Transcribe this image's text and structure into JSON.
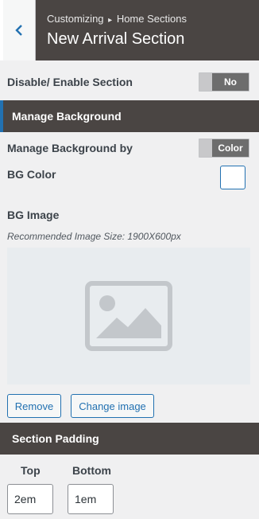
{
  "header": {
    "breadcrumb_parent": "Customizing",
    "breadcrumb_sep": "▸",
    "breadcrumb_child": "Home Sections",
    "title": "New Arrival Section"
  },
  "enable_section": {
    "label": "Disable/ Enable Section",
    "value": "No"
  },
  "manage_background": {
    "heading": "Manage Background",
    "by_label": "Manage Background by",
    "by_value": "Color",
    "bg_color_label": "BG Color",
    "bg_color_value": "#ffffff",
    "bg_image_label": "BG Image",
    "bg_image_hint": "Recommended Image Size: 1900X600px",
    "remove_label": "Remove",
    "change_label": "Change image"
  },
  "section_padding": {
    "heading": "Section Padding",
    "top_label": "Top",
    "top_value": "2em",
    "bottom_label": "Bottom",
    "bottom_value": "1em"
  },
  "colors": {
    "header_dark": "#4a4543",
    "accent": "#2271b1",
    "toggle_value_bg": "#6d6d6d"
  }
}
